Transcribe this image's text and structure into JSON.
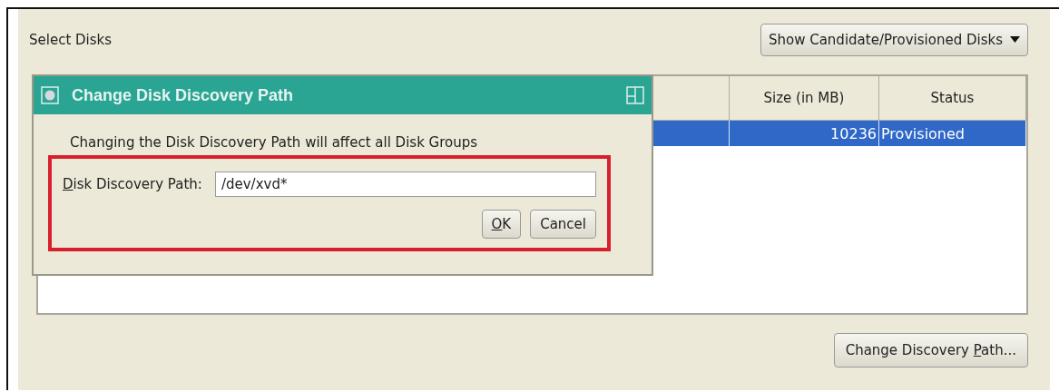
{
  "panel": {
    "title": "Select Disks",
    "filter_dropdown": "Show Candidate/Provisioned Disks"
  },
  "table": {
    "columns": [
      "Size (in MB)",
      "Status"
    ],
    "rows": [
      {
        "size": "10236",
        "status": "Provisioned",
        "selected": true
      }
    ]
  },
  "change_path_button": {
    "before": "Change Discovery ",
    "key": "P",
    "after": "ath..."
  },
  "dialog": {
    "title": "Change Disk Discovery Path",
    "message": "Changing the Disk Discovery Path will affect all Disk Groups",
    "field_label": {
      "key": "D",
      "after": "isk Discovery Path:"
    },
    "field_value": "/dev/xvd*",
    "buttons": [
      {
        "key": "O",
        "after": "K"
      },
      {
        "before": "Cancel"
      }
    ]
  }
}
